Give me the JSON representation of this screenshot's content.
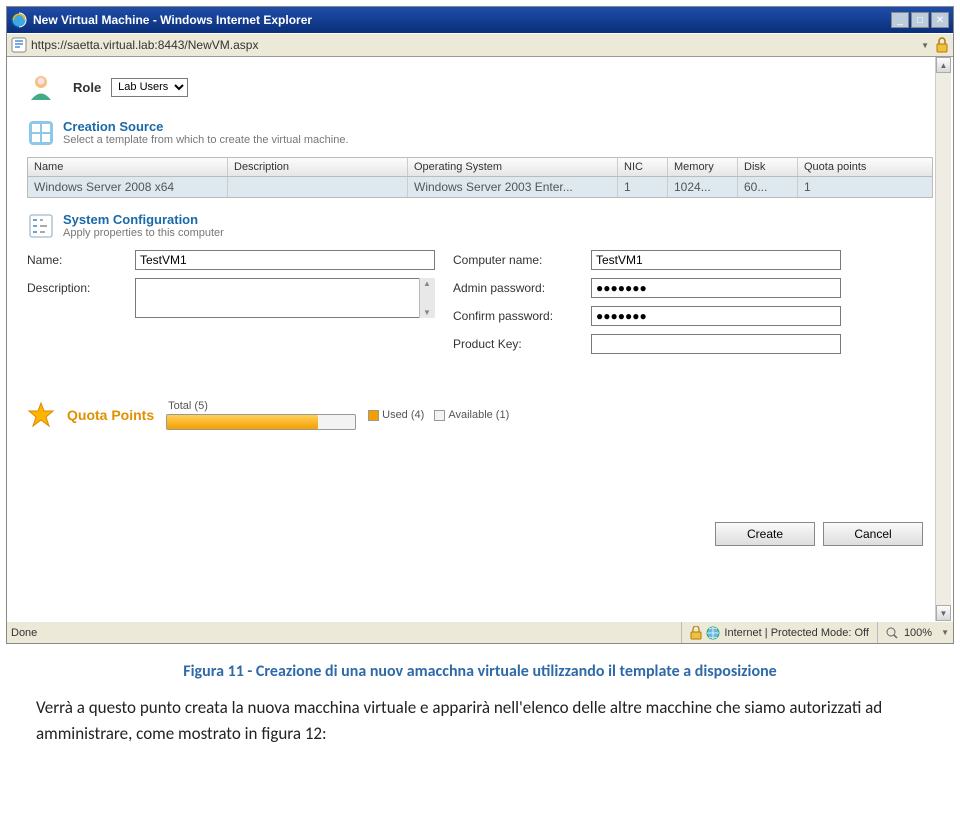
{
  "window": {
    "title": "New Virtual Machine - Windows Internet Explorer",
    "url": "https://saetta.virtual.lab:8443/NewVM.aspx"
  },
  "role": {
    "label": "Role",
    "selected": "Lab Users"
  },
  "creation_source": {
    "title": "Creation Source",
    "subtitle": "Select a template from which to create the virtual machine.",
    "columns": {
      "name": "Name",
      "description": "Description",
      "os": "Operating System",
      "nic": "NIC",
      "memory": "Memory",
      "disk": "Disk",
      "quota": "Quota points"
    },
    "row": {
      "name": "Windows Server 2008 x64",
      "description": "",
      "os": "Windows Server 2003 Enter...",
      "nic": "1",
      "memory": "1024...",
      "disk": "60...",
      "quота": "1",
      "quota": "1"
    }
  },
  "system_config": {
    "title": "System Configuration",
    "subtitle": "Apply properties to this computer",
    "labels": {
      "name": "Name:",
      "description": "Description:",
      "computer_name": "Computer name:",
      "admin_password": "Admin password:",
      "confirm_password": "Confirm password:",
      "product_key": "Product Key:"
    },
    "values": {
      "name": "TestVM1",
      "description": "",
      "computer_name": "TestVM1",
      "admin_password": "●●●●●●●",
      "confirm_password": "●●●●●●●",
      "product_key": ""
    }
  },
  "quota": {
    "title": "Quota Points",
    "total_label": "Total (5)",
    "used_label": "Used (4)",
    "available_label": "Available (1)",
    "used_pct": 80
  },
  "buttons": {
    "create": "Create",
    "cancel": "Cancel"
  },
  "status": {
    "left": "Done",
    "mode": "Internet | Protected Mode: Off",
    "zoom": "100%"
  },
  "caption": {
    "title": "Figura 11 - Creazione di una nuov amacchna virtuale utilizzando il template a disposizione",
    "body": "Verrà a questo punto creata la nuova macchina virtuale e apparirà nell'elenco delle altre macchine che siamo autorizzati ad amministrare, come mostrato in figura 12:"
  }
}
